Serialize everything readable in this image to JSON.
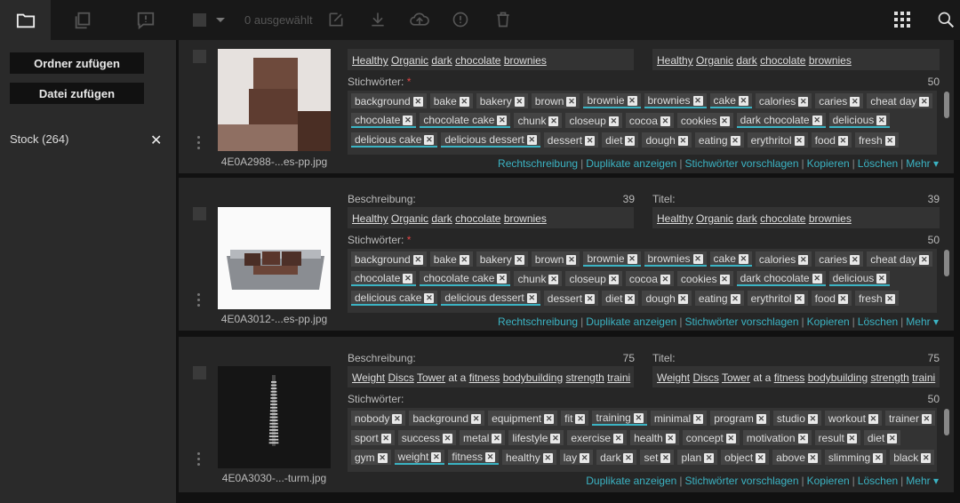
{
  "toolbar": {
    "selected_count": "0 ausgewählt"
  },
  "sidebar": {
    "add_folder": "Ordner zufügen",
    "add_file": "Datei zufügen",
    "stock_label": "Stock (264)"
  },
  "labels": {
    "description": "Beschreibung:",
    "title": "Titel:",
    "keywords": "Stichwörter:",
    "required_mark": "*"
  },
  "actions": {
    "spelling": "Rechtschreibung",
    "duplicates": "Duplikate anzeigen",
    "suggest": "Stichwörter vorschlagen",
    "copy": "Kopieren",
    "delete": "Löschen",
    "more": "Mehr ▾"
  },
  "items": [
    {
      "filename": "4E0A2988-...es-pp.jpg",
      "desc_count": "",
      "title_count": "",
      "kw_count": "50",
      "description": "Healthy Organic dark chocolate brownies",
      "title": "Healthy Organic dark chocolate brownies",
      "rows": [
        [
          "background",
          "bake",
          "bakery",
          "brown",
          "brownie",
          "brownies",
          "cake",
          "calories",
          "caries",
          "cheat day"
        ],
        [
          "chocolate",
          "chocolate cake",
          "chunk",
          "closeup",
          "cocoa",
          "cookies",
          "dark chocolate",
          "delicious"
        ],
        [
          "delicious cake",
          "delicious dessert",
          "dessert",
          "diet",
          "dough",
          "eating",
          "erythritol",
          "food",
          "fresh"
        ]
      ]
    },
    {
      "filename": "4E0A3012-...es-pp.jpg",
      "desc_count": "39",
      "title_count": "39",
      "kw_count": "50",
      "description": "Healthy Organic dark chocolate brownies",
      "title": "Healthy Organic dark chocolate brownies",
      "rows": [
        [
          "background",
          "bake",
          "bakery",
          "brown",
          "brownie",
          "brownies",
          "cake",
          "calories",
          "caries",
          "cheat day"
        ],
        [
          "chocolate",
          "chocolate cake",
          "chunk",
          "closeup",
          "cocoa",
          "cookies",
          "dark chocolate",
          "delicious"
        ],
        [
          "delicious cake",
          "delicious dessert",
          "dessert",
          "diet",
          "dough",
          "eating",
          "erythritol",
          "food",
          "fresh"
        ]
      ]
    },
    {
      "filename": "4E0A3030-...-turm.jpg",
      "desc_count": "75",
      "title_count": "75",
      "kw_count": "50",
      "description": "Weight Discs Tower at a fitness bodybuilding strength traini",
      "title": "Weight Discs Tower at a fitness bodybuilding strength traini",
      "rows": [
        [
          "nobody",
          "background",
          "equipment",
          "fit",
          "training",
          "minimal",
          "program",
          "studio",
          "workout",
          "trainer"
        ],
        [
          "sport",
          "success",
          "metal",
          "lifestyle",
          "exercise",
          "health",
          "concept",
          "motivation",
          "result",
          "diet"
        ],
        [
          "gym",
          "weight",
          "fitness",
          "healthy",
          "lay",
          "dark",
          "set",
          "plan",
          "object",
          "above",
          "slimming",
          "black"
        ]
      ]
    }
  ]
}
